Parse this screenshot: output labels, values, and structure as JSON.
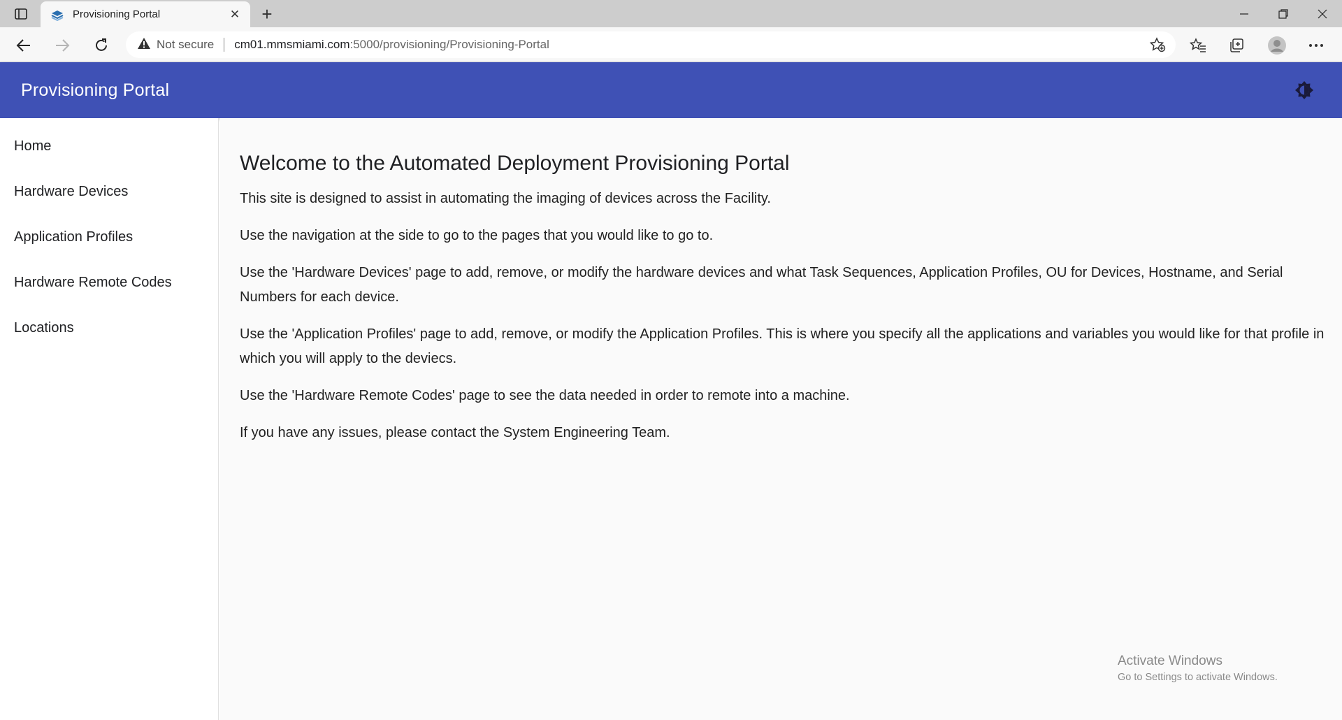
{
  "browser": {
    "tab_title": "Provisioning Portal",
    "new_tab_symbol": "+",
    "security_label": "Not secure",
    "url_host": "cm01.mmsmiami.com",
    "url_rest": ":5000/provisioning/Provisioning-Portal"
  },
  "app": {
    "title": "Provisioning Portal",
    "accent_color": "#3f51b5"
  },
  "sidebar": {
    "items": [
      {
        "label": "Home"
      },
      {
        "label": "Hardware Devices"
      },
      {
        "label": "Application Profiles"
      },
      {
        "label": "Hardware Remote Codes"
      },
      {
        "label": "Locations"
      }
    ]
  },
  "main": {
    "heading": "Welcome to the Automated Deployment Provisioning Portal",
    "paragraphs": [
      "This site is designed to assist in automating the imaging of devices across the Facility.",
      "Use the navigation at the side to go to the pages that you would like to go to.",
      "Use the 'Hardware Devices' page to add, remove, or modify the hardware devices and what Task Sequences, Application Profiles, OU for Devices, Hostname, and Serial Numbers for each device.",
      "Use the 'Application Profiles' page to add, remove, or modify the Application Profiles. This is where you specify all the applications and variables you would like for that profile in which you will apply to the deviecs.",
      "Use the 'Hardware Remote Codes' page to see the data needed in order to remote into a machine.",
      "If you have any issues, please contact the System Engineering Team."
    ]
  },
  "watermark": {
    "title": "Activate Windows",
    "subtitle": "Go to Settings to activate Windows."
  }
}
